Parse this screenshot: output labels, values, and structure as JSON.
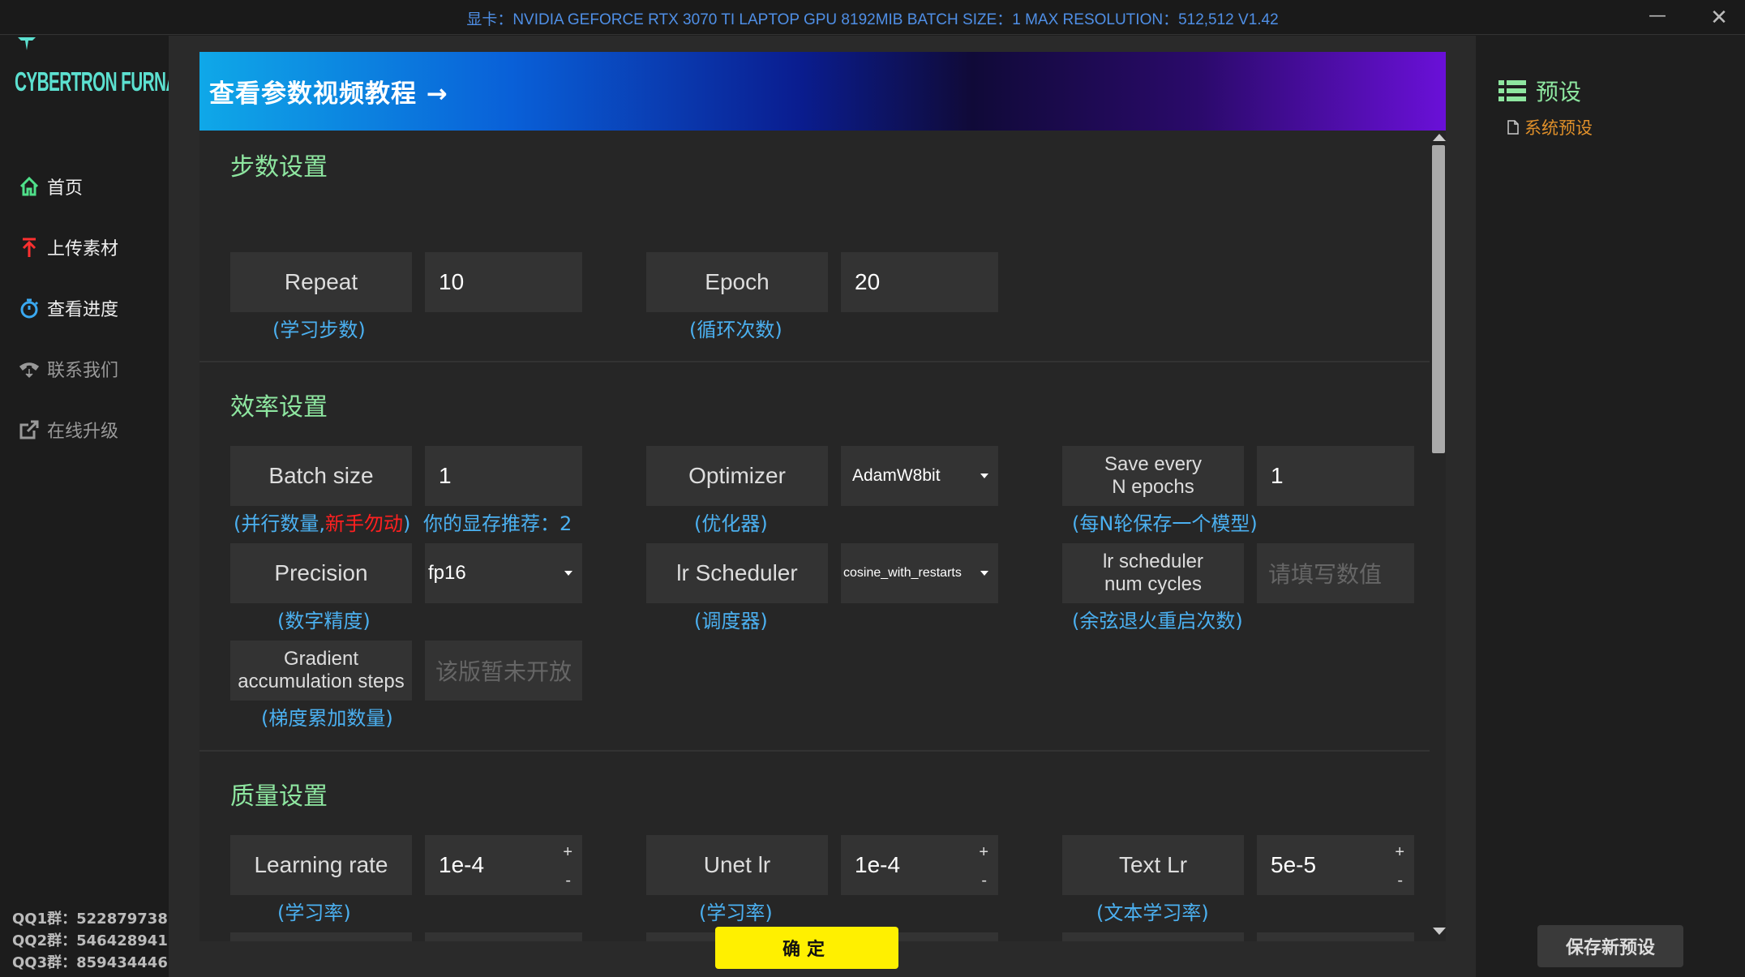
{
  "titlebar": {
    "title": "显卡：NVIDIA GEFORCE RTX 3070 TI LAPTOP GPU 8192MIB  BATCH SIZE：1  MAX RESOLUTION：512,512 V1.42",
    "minimize": "—",
    "close": "✕"
  },
  "sidebar": {
    "logo": "CYBERTRON FURNACE",
    "nav": [
      {
        "label": "首页",
        "icon": "home-icon"
      },
      {
        "label": "上传素材",
        "icon": "upload-icon"
      },
      {
        "label": "查看进度",
        "icon": "timer-icon"
      },
      {
        "label": "联系我们",
        "icon": "phone-icon"
      },
      {
        "label": "在线升级",
        "icon": "external-link-icon"
      }
    ],
    "qq": [
      "QQ1群：522879738",
      "QQ2群：546428941",
      "QQ3群：859434446"
    ]
  },
  "banner": {
    "text": "查看参数视频教程 →"
  },
  "sections": {
    "steps": {
      "title": "步数设置",
      "repeat_label": "Repeat",
      "repeat_value": "10",
      "repeat_hint": "(学习步数)",
      "epoch_label": "Epoch",
      "epoch_value": "20",
      "epoch_hint": "(循环次数)"
    },
    "efficiency": {
      "title": "效率设置",
      "batch_label": "Batch size",
      "batch_value": "1",
      "batch_hint_a": "(并行数量,",
      "batch_hint_red": "新手勿动",
      "batch_hint_b": ")",
      "vram_hint": "你的显存推荐：2",
      "optimizer_label": "Optimizer",
      "optimizer_value": "AdamW8bit",
      "optimizer_hint": "(优化器)",
      "save_label_1": "Save every",
      "save_label_2": "N epochs",
      "save_value": "1",
      "save_hint": "(每N轮保存一个模型)",
      "precision_label": "Precision",
      "precision_value": "fp16",
      "precision_hint": "(数字精度)",
      "scheduler_label": "lr Scheduler",
      "scheduler_value": "cosine_with_restarts",
      "scheduler_hint": "(调度器)",
      "cycles_label_1": "lr scheduler",
      "cycles_label_2": "num cycles",
      "cycles_placeholder": "请填写数值",
      "cycles_hint": "(余弦退火重启次数)",
      "grad_label_1": "Gradient",
      "grad_label_2": "accumulation steps",
      "grad_placeholder": "该版暂未开放",
      "grad_hint": "(梯度累加数量)"
    },
    "quality": {
      "title": "质量设置",
      "lr_label": "Learning rate",
      "lr_value": "1e-4",
      "lr_hint": "(学习率)",
      "unet_label": "Unet lr",
      "unet_value": "1e-4",
      "unet_hint": "(学习率)",
      "text_label": "Text Lr",
      "text_value": "5e-5",
      "text_hint": "(文本学习率)",
      "spin_up": "+",
      "spin_down": "-"
    }
  },
  "ok_button": "确定",
  "right_panel": {
    "title": "预设",
    "item": "系统预设",
    "save_button": "保存新预设"
  },
  "colors": {
    "accent_green": "#8ee6a0",
    "hint_blue": "#4bb0f0",
    "warning_red": "#ff2020",
    "ok_yellow": "#fff000",
    "preset_orange": "#e0902a"
  }
}
